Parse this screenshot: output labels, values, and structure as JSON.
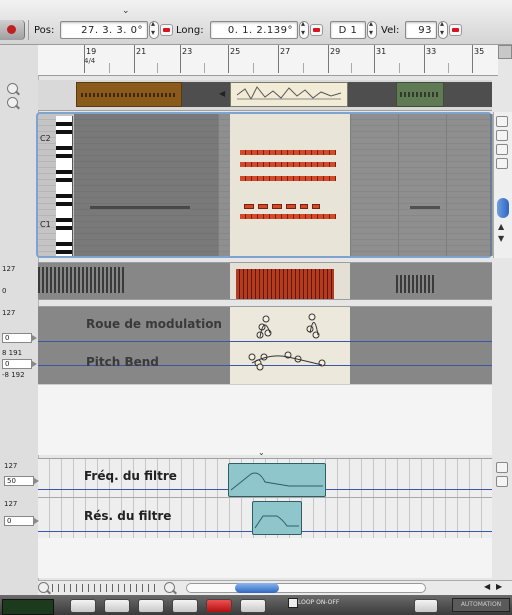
{
  "toolbar": {
    "top_tick": "⌄",
    "pos_label": "Pos:",
    "pos_value": "27. 3. 3.   0°",
    "long_label": "Long:",
    "long_value": "0. 1. 2.139°",
    "note_value": "D 1",
    "vel_label": "Vel:",
    "vel_value": "93"
  },
  "ruler": {
    "bars": [
      "19",
      "21",
      "23",
      "25",
      "27",
      "29",
      "31",
      "33",
      "35"
    ],
    "time_signature": "4/4"
  },
  "piano_roll": {
    "labels": [
      "C2",
      "C1"
    ]
  },
  "velocity": {
    "max": "127",
    "min": "0"
  },
  "controllers": {
    "max": "127",
    "field_1": "0",
    "field_2_top": "8 191",
    "field_2": "0",
    "field_2_bottom": "-8 192",
    "modulation_label": "Roue de modulation",
    "pitchbend_label": "Pitch Bend"
  },
  "filters": {
    "freq_max": "127",
    "freq_value": "50",
    "freq_label": "Fréq. du filtre",
    "res_max": "127",
    "res_value": "0",
    "res_label": "Rés. du filtre"
  },
  "bottom_bar": {
    "loop_label": "LOOP ON-OFF",
    "automation_label": "AUTOMATION"
  },
  "colors": {
    "accent_blue": "#2e67c2",
    "record_red": "#d8141e",
    "filter_region": "#8ec6cb",
    "note_red": "#d44a28"
  }
}
